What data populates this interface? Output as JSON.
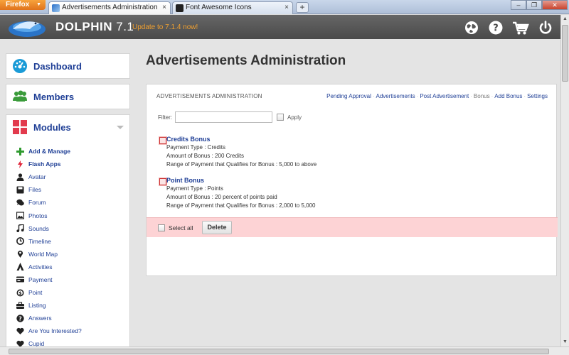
{
  "browser": {
    "menu_label": "Firefox",
    "tabs": [
      {
        "title": "Advertisements Administration",
        "active": true
      },
      {
        "title": "Font Awesome Icons",
        "active": false
      }
    ],
    "new_tab": "+",
    "close_glyph": "×"
  },
  "header": {
    "brand": "DOLPHIN",
    "version": "7.1",
    "update_link": "Update to 7.1.4 now!",
    "icons": [
      "globe-icon",
      "help-icon",
      "cart-icon",
      "power-icon"
    ]
  },
  "sidebar": {
    "dashboard": "Dashboard",
    "members": "Members",
    "modules": "Modules",
    "module_items": [
      {
        "label": "Add & Manage",
        "icon": "plus-icon",
        "bold": true
      },
      {
        "label": "Flash Apps",
        "icon": "bolt-icon",
        "bold": true
      },
      {
        "label": "Avatar",
        "icon": "user-icon"
      },
      {
        "label": "Files",
        "icon": "disk-icon"
      },
      {
        "label": "Forum",
        "icon": "comments-icon"
      },
      {
        "label": "Photos",
        "icon": "picture-icon"
      },
      {
        "label": "Sounds",
        "icon": "music-icon"
      },
      {
        "label": "Timeline",
        "icon": "clock-icon"
      },
      {
        "label": "World Map",
        "icon": "map-marker-icon"
      },
      {
        "label": "Activities",
        "icon": "activities-icon"
      },
      {
        "label": "Payment",
        "icon": "credit-card-icon"
      },
      {
        "label": "Point",
        "icon": "point-icon"
      },
      {
        "label": "Listing",
        "icon": "briefcase-icon"
      },
      {
        "label": "Answers",
        "icon": "question-icon"
      },
      {
        "label": "Are You Interested?",
        "icon": "heart-icon"
      },
      {
        "label": "Cupid",
        "icon": "heart-icon"
      }
    ]
  },
  "main": {
    "page_title": "Advertisements Administration",
    "panel_title": "ADVERTISEMENTS ADMINISTRATION",
    "nav_links": [
      {
        "label": "Pending Approval",
        "active": false
      },
      {
        "label": "Advertisements",
        "active": false
      },
      {
        "label": "Post Advertisement",
        "active": false
      },
      {
        "label": "Bonus",
        "active": true
      },
      {
        "label": "Add Bonus",
        "active": false
      },
      {
        "label": "Settings",
        "active": false
      }
    ],
    "filter_label": "Filter:",
    "filter_value": "",
    "apply_label": "Apply",
    "entries": [
      {
        "title": "Credits Bonus",
        "lines": [
          "Payment Type : Credits",
          "Amount of Bonus : 200 Credits",
          "Range of Payment that Qualifies for Bonus : 5,000 to above"
        ]
      },
      {
        "title": "Point Bonus",
        "lines": [
          "Payment Type : Points",
          "Amount of Bonus : 20 percent of points paid",
          "Range of Payment that Qualifies for Bonus : 2,000 to 5,000"
        ]
      }
    ],
    "select_all_label": "Select all",
    "delete_label": "Delete"
  }
}
